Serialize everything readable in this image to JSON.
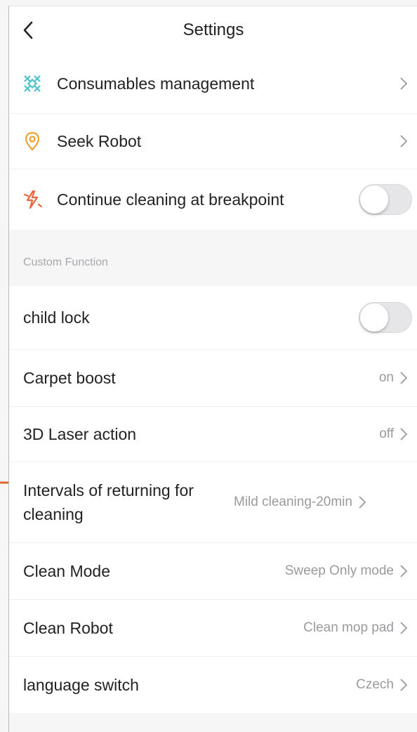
{
  "header": {
    "title": "Settings"
  },
  "top_rows": [
    {
      "label": "Consumables management",
      "icon": "consumables-icon"
    },
    {
      "label": "Seek Robot",
      "icon": "location-pin-icon"
    },
    {
      "label": "Continue cleaning at breakpoint",
      "icon": "breakpoint-icon",
      "toggle": false
    }
  ],
  "section": {
    "label": "Custom Function"
  },
  "custom_rows": [
    {
      "label": "child lock",
      "toggle": false
    },
    {
      "label": "Carpet boost",
      "value": "on"
    },
    {
      "label": "3D Laser action",
      "value": "off"
    },
    {
      "label": "Intervals of returning for cleaning",
      "value": "Mild cleaning-20min"
    },
    {
      "label": "Clean Mode",
      "value": "Sweep Only mode"
    },
    {
      "label": "Clean Robot",
      "value": "Clean mop pad"
    },
    {
      "label": "language switch",
      "value": "Czech"
    }
  ],
  "colors": {
    "accent_teal": "#4fc3c9",
    "accent_orange": "#f0a030",
    "accent_red": "#e8663a",
    "marker": "#e06a2c"
  }
}
